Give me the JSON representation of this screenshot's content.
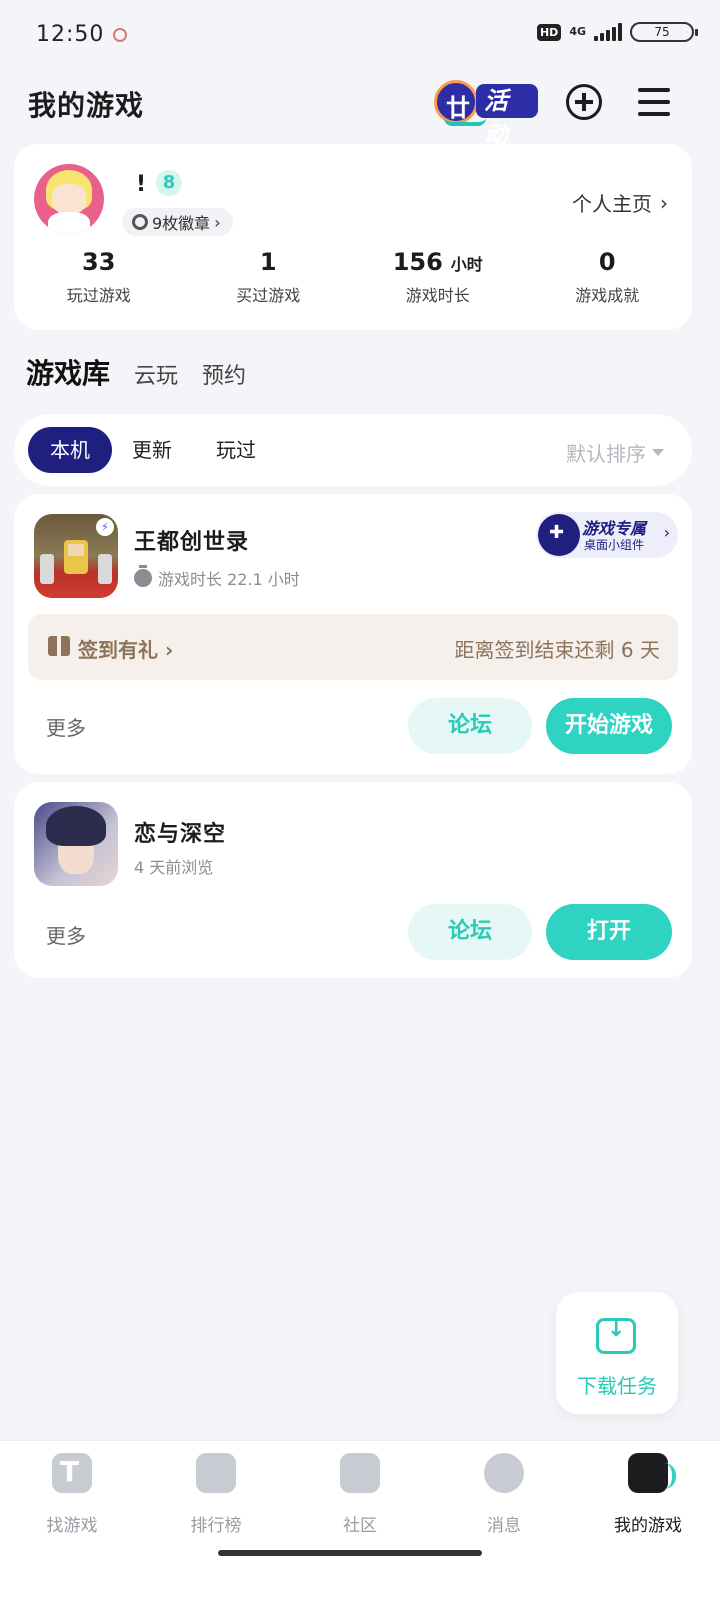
{
  "status_bar": {
    "time": "12:50",
    "hd": "HD",
    "network": "4G",
    "battery": "75"
  },
  "header": {
    "title": "我的游戏",
    "activity_label": "活动"
  },
  "profile": {
    "username": "!",
    "level": "8",
    "badges_label": "9枚徽章",
    "home_link": "个人主页",
    "stats": [
      {
        "value": "33",
        "unit": "",
        "label": "玩过游戏"
      },
      {
        "value": "1",
        "unit": "",
        "label": "买过游戏"
      },
      {
        "value": "156",
        "unit": "小时",
        "label": "游戏时长"
      },
      {
        "value": "0",
        "unit": "",
        "label": "游戏成就"
      }
    ]
  },
  "library_tabs": [
    "游戏库",
    "云玩",
    "预约"
  ],
  "filters": {
    "items": [
      "本机",
      "更新",
      "玩过"
    ],
    "sort_label": "默认排序"
  },
  "games": [
    {
      "title": "王都创世录",
      "subtitle": "游戏时长 22.1 小时",
      "widget_title": "游戏专属",
      "widget_sub": "桌面小组件",
      "signin_label": "签到有礼",
      "signin_remaining": "距离签到结束还剩 6 天",
      "more": "更多",
      "forum": "论坛",
      "primary": "开始游戏"
    },
    {
      "title": "恋与深空",
      "subtitle": "4 天前浏览",
      "more": "更多",
      "forum": "论坛",
      "primary": "打开"
    }
  ],
  "download_task": "下载任务",
  "bottom_nav": [
    "找游戏",
    "排行榜",
    "社区",
    "消息",
    "我的游戏"
  ],
  "colors": {
    "accent_teal": "#2ed3c2",
    "brand_navy": "#1e1f7e",
    "signin_brown": "#8d7359"
  }
}
